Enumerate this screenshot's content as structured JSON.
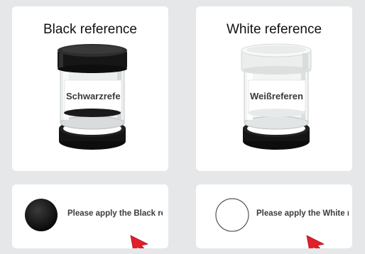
{
  "black_card": {
    "title": "Black reference",
    "jar_label": "Schwarzrefe"
  },
  "white_card": {
    "title": "White reference",
    "jar_label": "Weißreferen"
  },
  "black_prompt": {
    "text": "Please apply the Black reference"
  },
  "white_prompt": {
    "text": "Please apply the White reference"
  },
  "colors": {
    "background": "#e6e7e9",
    "card": "#ffffff",
    "cursor": "#e0202a",
    "black_dot": "#0c0c0c"
  },
  "icons": [
    "black-reference-jar",
    "white-reference-jar",
    "black-circle-icon",
    "white-circle-icon",
    "red-pointer-cursor-icon"
  ]
}
